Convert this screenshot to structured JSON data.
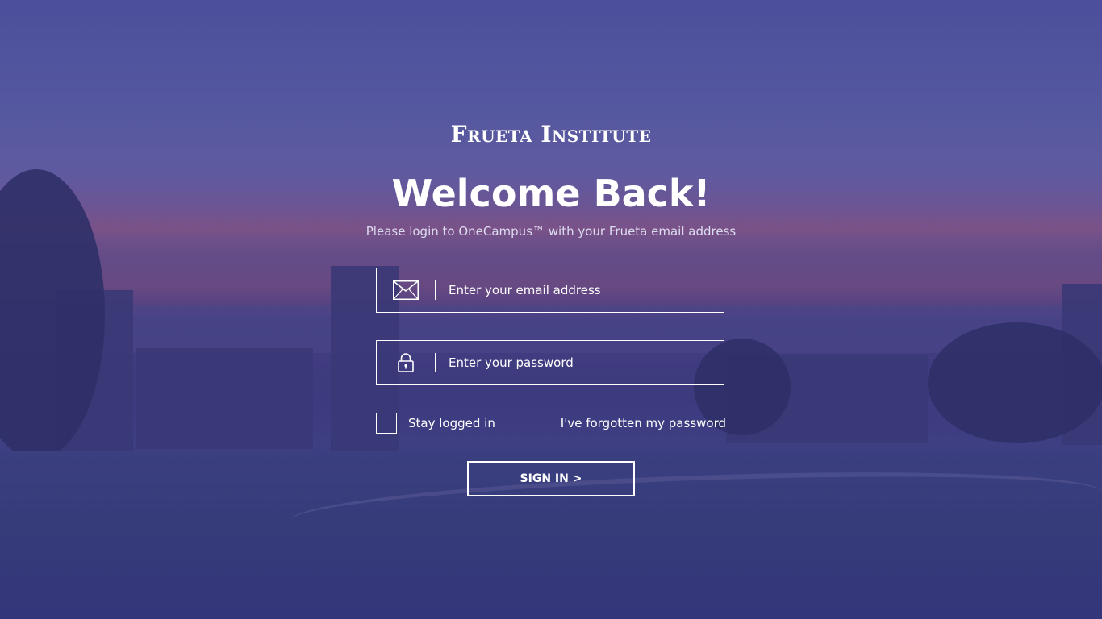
{
  "brand": {
    "name": "Frueta Institute"
  },
  "header": {
    "title": "Welcome Back!",
    "subtitle": "Please login to OneCampus™ with your Frueta email address"
  },
  "form": {
    "email": {
      "icon": "envelope-icon",
      "placeholder": "Enter your email address",
      "value": ""
    },
    "password": {
      "icon": "lock-icon",
      "placeholder": "Enter your password",
      "value": ""
    },
    "stay_logged_in": {
      "label": "Stay logged in",
      "checked": false
    },
    "forgot_password": {
      "label": "I've forgotten my password"
    },
    "submit": {
      "label": "SIGN IN >"
    }
  },
  "colors": {
    "overlay": "#4a4a9a",
    "text": "#ffffff",
    "subtitle_text": "#dcdcf0"
  }
}
